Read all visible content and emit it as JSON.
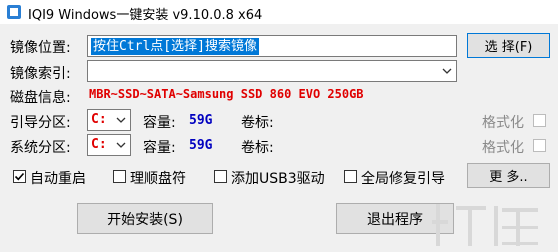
{
  "title": "IQI9 Windows一键安装 v9.10.0.8 x64",
  "mirror_location": {
    "label": "镜像位置:",
    "value": "按住Ctrl点[选择]搜索镜像",
    "browse_button": "选 择(F)"
  },
  "mirror_index": {
    "label": "镜像索引:",
    "value": ""
  },
  "disk_info": {
    "label": "磁盘信息:",
    "value": "MBR~SSD~SATA~Samsung SSD 860 EVO 250GB"
  },
  "boot_partition": {
    "label": "引导分区:",
    "drive": "C:",
    "capacity_label": "容量:",
    "capacity": "59G",
    "volume_label": "卷标:",
    "volume": "",
    "format_label": "格式化",
    "format_checked": false
  },
  "system_partition": {
    "label": "系统分区:",
    "drive": "C:",
    "capacity_label": "容量:",
    "capacity": "59G",
    "volume_label": "卷标:",
    "volume": "",
    "format_label": "格式化",
    "format_checked": false
  },
  "options": [
    {
      "label": "自动重启",
      "checked": true
    },
    {
      "label": "理顺盘符",
      "checked": false
    },
    {
      "label": "添加USB3驱动",
      "checked": false
    },
    {
      "label": "全局修复引导",
      "checked": false
    }
  ],
  "more_button": "更 多..",
  "start_button": "开始安装(S)",
  "exit_button": "退出程序",
  "colors": {
    "selection": "#0078d7",
    "disk_info": "#e00000",
    "drive": "#e00000",
    "capacity": "#0000c0"
  }
}
